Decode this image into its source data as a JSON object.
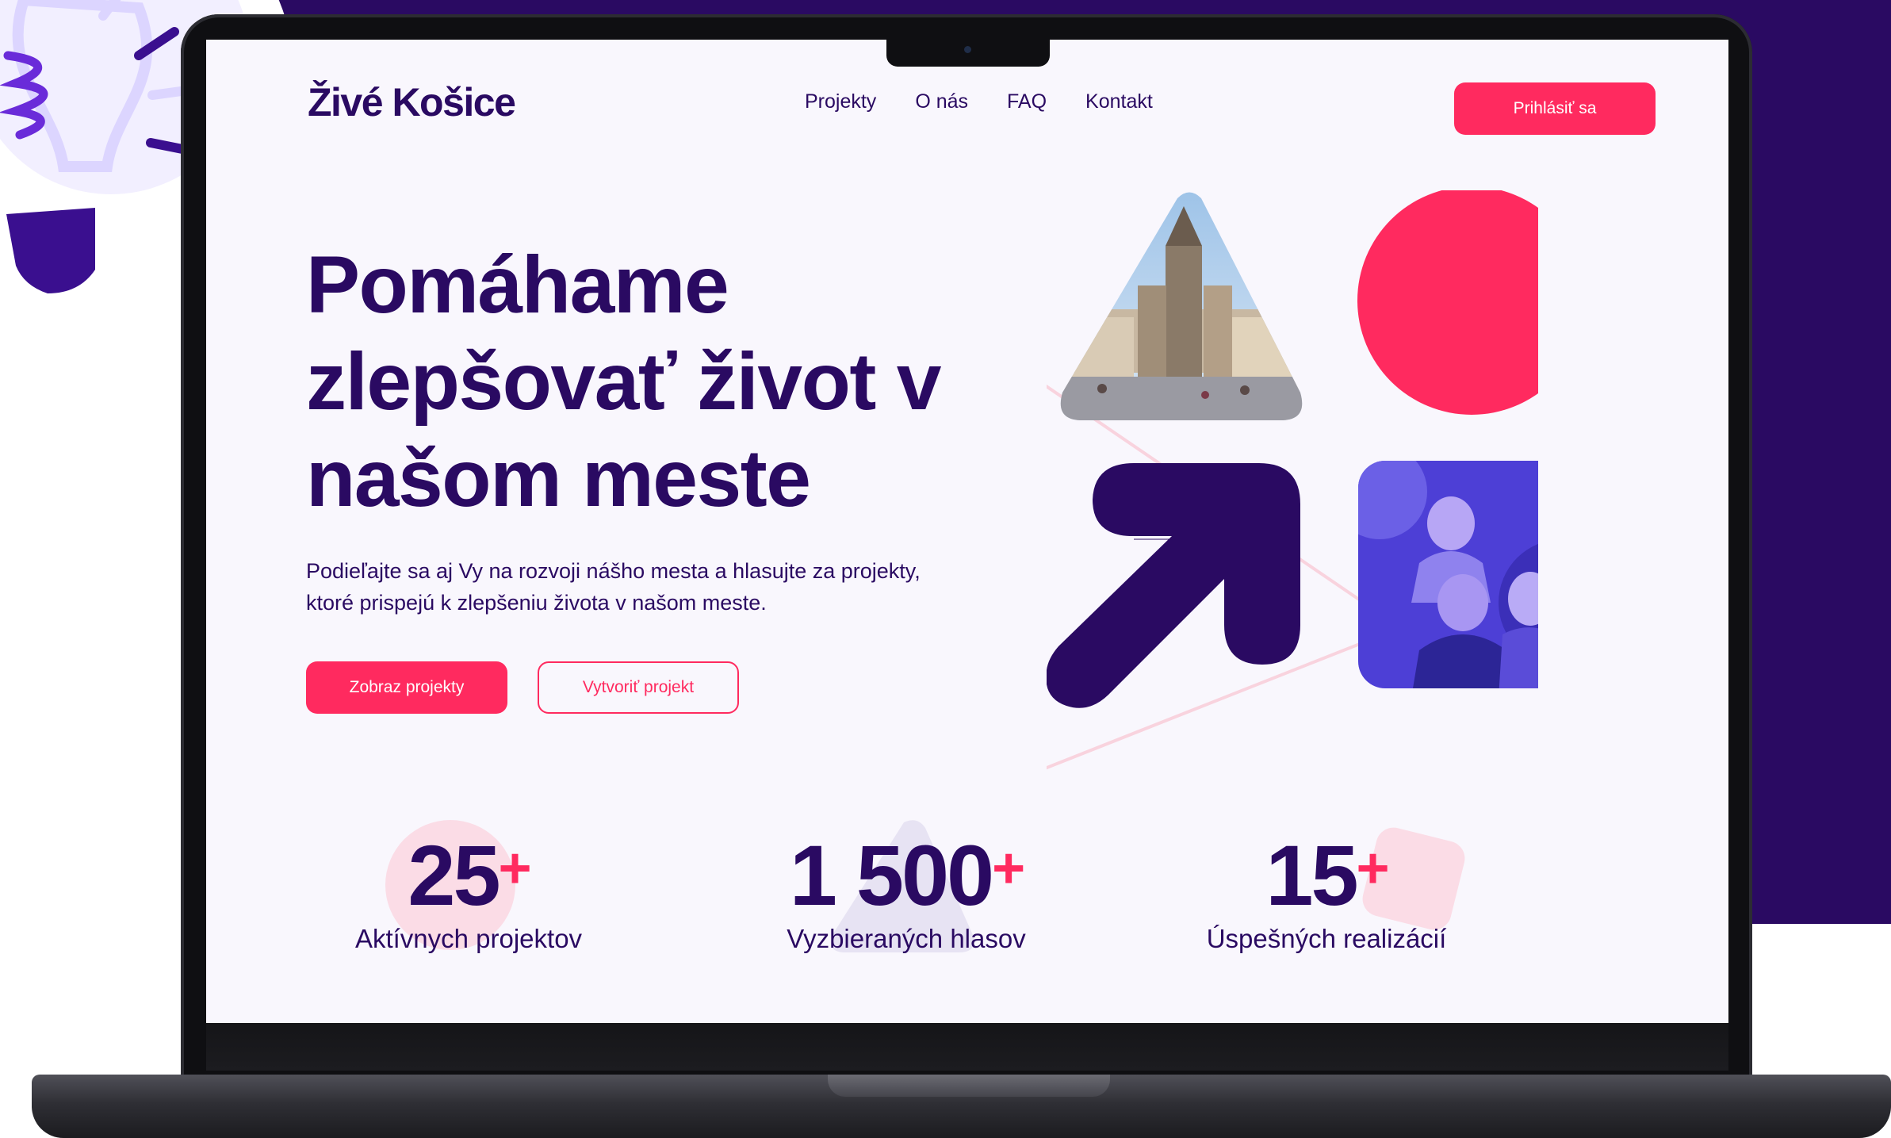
{
  "brand": {
    "logo": "Živé Košice"
  },
  "nav": {
    "items": [
      "Projekty",
      "O nás",
      "FAQ",
      "Kontakt"
    ],
    "login_label": "Prihlásiť sa"
  },
  "hero": {
    "title": "Pomáhame zlepšovať život v našom meste",
    "description": "Podieľajte sa aj Vy na rozvoji nášho mesta a hlasujte za projekty, ktoré prispejú k zlepšeniu života v našom meste.",
    "primary_button": "Zobraz projekty",
    "secondary_button": "Vytvoriť projekt"
  },
  "stats": [
    {
      "value": "25",
      "suffix": "+",
      "label": "Aktívnych projektov"
    },
    {
      "value": "1 500",
      "suffix": "+",
      "label": "Vyzbieraných hlasov"
    },
    {
      "value": "15",
      "suffix": "+",
      "label": "Úspešných realizácií"
    }
  ],
  "colors": {
    "brand_purple": "#2a0a62",
    "accent_pink": "#ff2a5f",
    "screen_bg": "#f9f7fd"
  },
  "icons": {
    "decoration": "lightbulb-icon",
    "hero_arrow": "arrow-up-right-icon"
  }
}
